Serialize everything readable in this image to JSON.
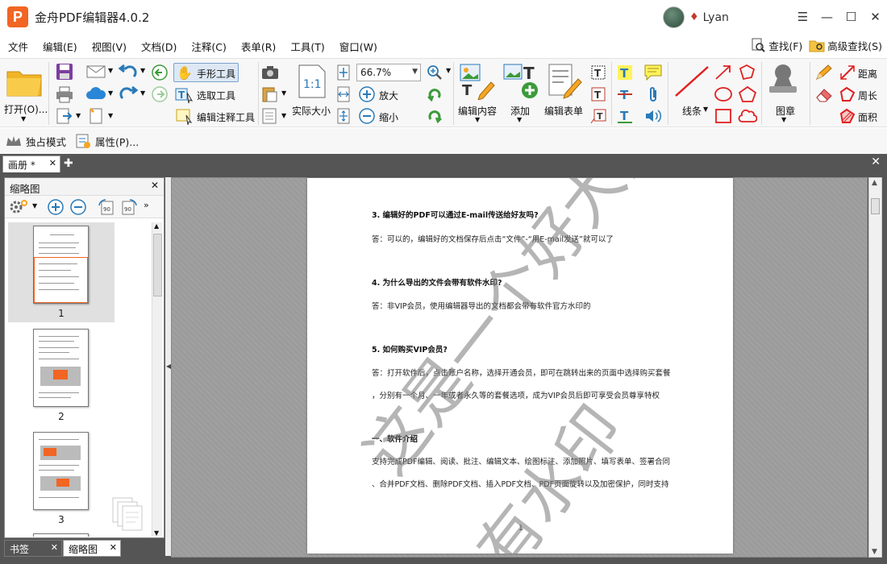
{
  "app": {
    "title": "金舟PDF编辑器4.0.2",
    "logo_letter": "P",
    "user_name": "Lyan"
  },
  "window_controls": {
    "menu": "☰",
    "minimize": "—",
    "maximize": "☐",
    "close": "✕"
  },
  "menu": {
    "items": [
      "文件",
      "编辑(E)",
      "视图(V)",
      "文档(D)",
      "注释(C)",
      "表单(R)",
      "工具(T)",
      "窗口(W)"
    ],
    "find": "查找(F)",
    "advanced_find": "高级查找(S)"
  },
  "ribbon": {
    "open": "打开(O)...",
    "hand_tool": "手形工具",
    "select_tool": "选取工具",
    "edit_annot_tool": "编辑注释工具",
    "actual_size": "实际大小",
    "zoom_value": "66.7%",
    "zoom_in": "放大",
    "zoom_out": "缩小",
    "edit_content": "编辑内容",
    "add": "添加",
    "edit_form": "编辑表单",
    "line": "线条",
    "stamp": "图章",
    "distance": "距离",
    "perimeter": "周长",
    "area": "面积"
  },
  "subbar": {
    "exclusive_mode": "独占模式",
    "properties": "属性(P)..."
  },
  "tabs": {
    "doc_tab": "画册 *"
  },
  "panel": {
    "title": "缩略图",
    "pages": [
      "1",
      "2",
      "3"
    ],
    "bottom_tabs": [
      "书签",
      "缩略图"
    ]
  },
  "document": {
    "lines": [
      {
        "text": "3. 编辑好的PDF可以通过E-mail传送给好友吗?",
        "bold": true
      },
      {
        "text": "答：可以的，编辑好的文档保存后点击“文件”-“用E-mail发送”就可以了",
        "bold": false
      },
      {
        "text": "4. 为什么导出的文件会带有软件水印?",
        "bold": true
      },
      {
        "text": "答：非VIP会员，使用编辑器导出的文档都会带有软件官方水印的",
        "bold": false
      },
      {
        "text": "5. 如何购买VIP会员?",
        "bold": true
      },
      {
        "text": "答：打开软件后，点击账户名称，选择开通会员，即可在跳转出来的页面中选择购买套餐",
        "bold": false
      },
      {
        "text": "，分别有一个月、一年或者永久等的套餐选项，成为VIP会员后即可享受会员尊享特权",
        "bold": false
      },
      {
        "text": "一、软件介绍",
        "bold": true
      },
      {
        "text": "支持完成PDF编辑、阅读、批注、编辑文本、绘图标注、添加照片、填写表单、签署合同",
        "bold": false
      },
      {
        "text": "、合并PDF文档、删除PDF文档、插入PDF文档、PDF页面旋转以及加密保护，同时支持",
        "bold": false
      }
    ],
    "page_number": "1",
    "watermark_line1": "这是一个好大的",
    "watermark_line2": "有水印"
  },
  "colors": {
    "accent_orange": "#f26522",
    "toolbar_bg": "#f7f7f7",
    "dark_bg": "#555555"
  }
}
